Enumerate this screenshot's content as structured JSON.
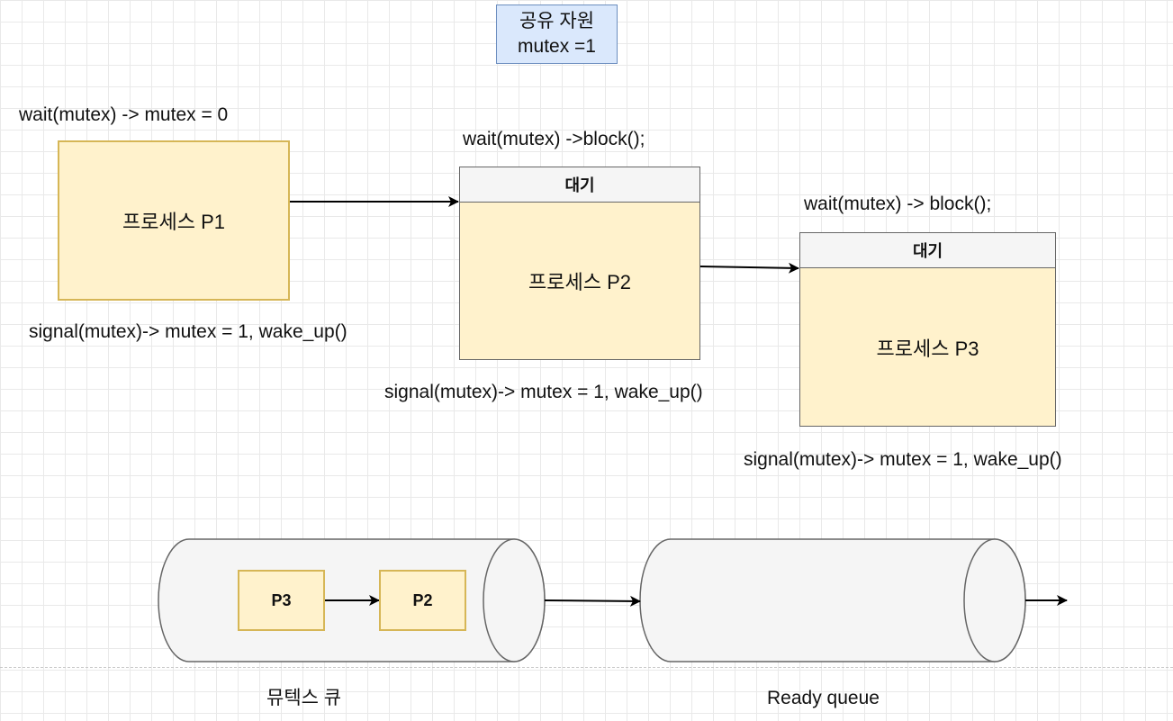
{
  "resource": {
    "line1": "공유 자원",
    "line2": "mutex =1"
  },
  "p1": {
    "label": "프로세스 P1",
    "wait": "wait(mutex) -> mutex = 0",
    "signal": "signal(mutex)-> mutex = 1, wake_up()"
  },
  "p2": {
    "header": "대기",
    "label": "프로세스 P2",
    "wait": "wait(mutex) ->block();",
    "signal": "signal(mutex)-> mutex = 1, wake_up()"
  },
  "p3": {
    "header": "대기",
    "label": "프로세스 P3",
    "wait": "wait(mutex) -> block();",
    "signal": "signal(mutex)-> mutex = 1, wake_up()"
  },
  "mutex_queue": {
    "label": "뮤텍스 큐",
    "items": [
      "P3",
      "P2"
    ]
  },
  "ready_queue": {
    "label": "Ready queue"
  },
  "colors": {
    "process_fill": "#fff2cc",
    "process_stroke": "#d6b656",
    "resource_fill": "#dae8fc",
    "resource_stroke": "#6c8ebf",
    "header_fill": "#f5f5f5",
    "cylinder_fill": "#f5f5f5"
  }
}
